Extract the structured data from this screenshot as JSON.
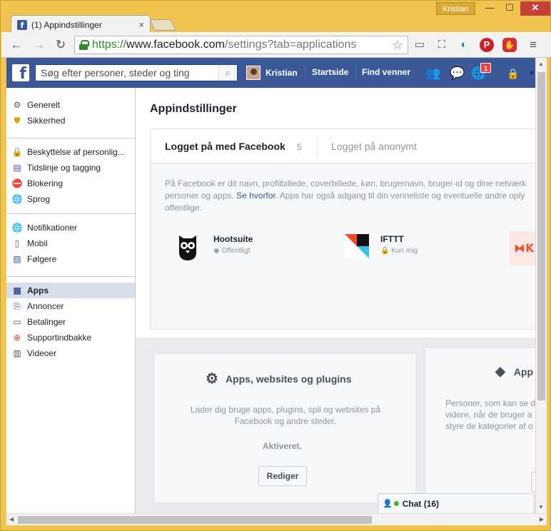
{
  "browser": {
    "tab_title": "(1) Appindstillinger",
    "tab_close": "×",
    "profile_name": "Kristian",
    "window_min": "—",
    "window_max": "☐",
    "window_close": "✕",
    "url_scheme": "https://",
    "url_host": "www.facebook.com",
    "url_path": "/settings?tab=applications",
    "icons": [
      "back-icon",
      "forward-icon",
      "reload-icon",
      "lock-icon",
      "star-icon",
      "cast-icon",
      "screenshot-icon",
      "extension-icon",
      "pinterest-icon",
      "adblock-icon",
      "menu-icon"
    ]
  },
  "fb_header": {
    "search_placeholder": "Søg efter personer, steder og ting",
    "user_name": "Kristian",
    "nav_home": "Startside",
    "nav_find_friends": "Find venner",
    "notification_count": "1",
    "brand_color": "#3b5998"
  },
  "sidebar": {
    "group1": [
      {
        "label": "Generelt",
        "icon": "gears-icon"
      },
      {
        "label": "Sikkerhed",
        "icon": "shield-icon"
      }
    ],
    "group2": [
      {
        "label": "Beskyttelse af personlig...",
        "icon": "privacy-lock-icon"
      },
      {
        "label": "Tidslinje og tagging",
        "icon": "timeline-icon"
      },
      {
        "label": "Blokering",
        "icon": "block-icon"
      },
      {
        "label": "Sprog",
        "icon": "globe-icon"
      }
    ],
    "group3": [
      {
        "label": "Notifikationer",
        "icon": "globe-notifications-icon"
      },
      {
        "label": "Mobil",
        "icon": "mobile-icon"
      },
      {
        "label": "Følgere",
        "icon": "rss-icon"
      }
    ],
    "group4": [
      {
        "label": "Apps",
        "icon": "apps-icon",
        "selected": true
      },
      {
        "label": "Annoncer",
        "icon": "ads-icon"
      },
      {
        "label": "Betalinger",
        "icon": "payment-card-icon"
      },
      {
        "label": "Supportindbakke",
        "icon": "lifebuoy-icon"
      },
      {
        "label": "Videoer",
        "icon": "film-icon"
      }
    ]
  },
  "main": {
    "title": "Appindstillinger",
    "tab_logged_in": "Logget på med Facebook",
    "tab_logged_in_count": "5",
    "tab_anonymous": "Logget på anonymt",
    "description_part1": "På Facebook er dit navn, profilbillede, coverbillede, køn, brugernavn, bruger-id og dine netværk",
    "description_part2": "personer og apps.",
    "description_link": "Se hvorfor",
    "description_part3": ". Apps har også adgang til din venneliste og eventuelle andre oply",
    "description_part4": "offentlige.",
    "apps": [
      {
        "name": "Hootsuite",
        "visibility": "Offentligt",
        "icon": "hootsuite-owl-icon"
      },
      {
        "name": "IFTTT",
        "visibility": "Kun mig",
        "icon": "ifttt-icon"
      }
    ]
  },
  "cards": {
    "card1": {
      "title": "Apps, websites og plugins",
      "description": "Lader dig bruge apps, plugins, spil og websites på Facebook og andre steder.",
      "state": "Aktiveret.",
      "button": "Rediger"
    },
    "card2": {
      "title": "App",
      "desc_line1": "Personer, som kan se d",
      "desc_line2": "videre, når de bruger a",
      "desc_line3": "styre de kategorier af o"
    }
  },
  "chat": {
    "label": "Chat (16)"
  }
}
